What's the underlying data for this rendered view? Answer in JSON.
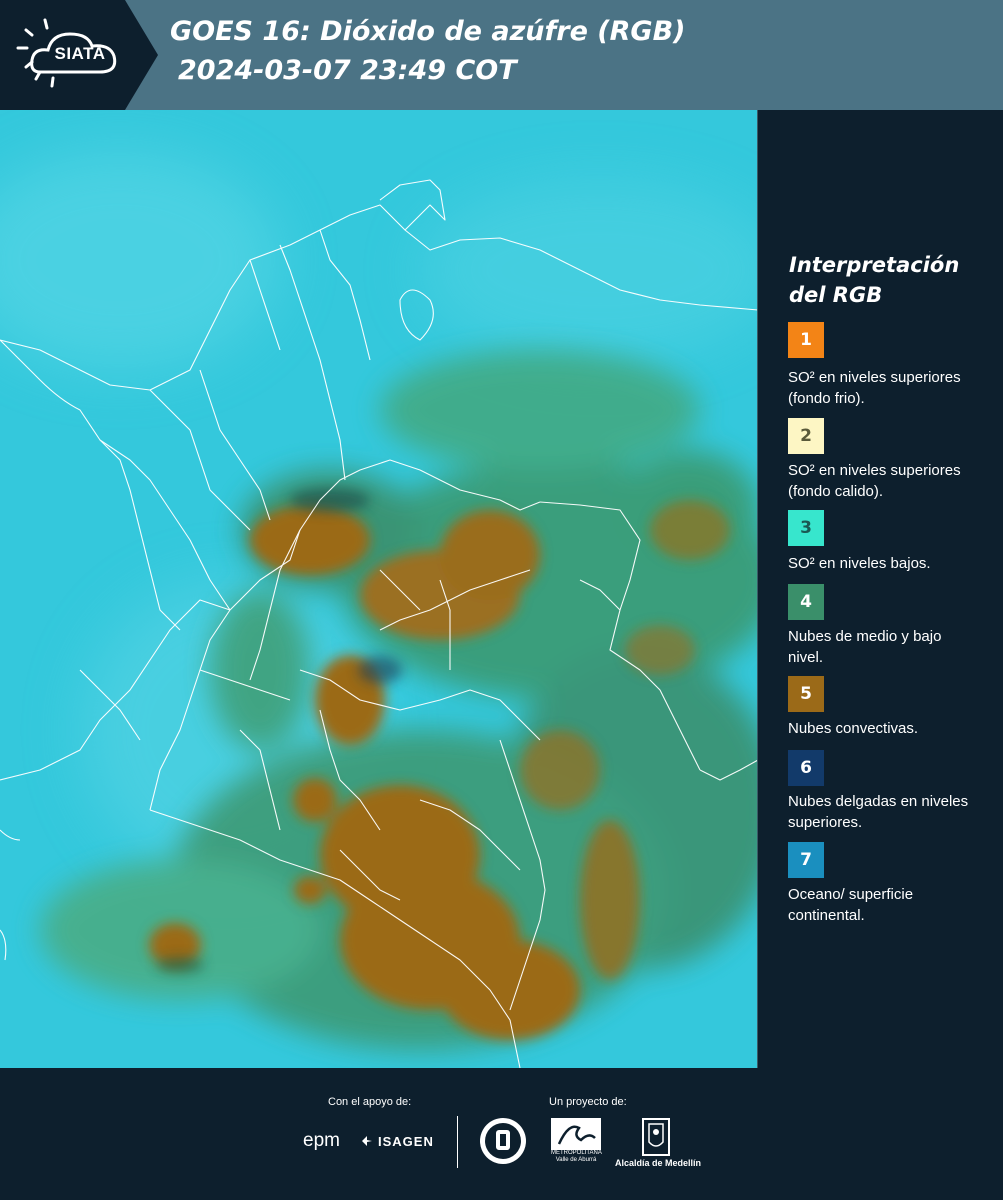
{
  "header": {
    "logo_text": "SIATA",
    "title_line1": "GOES 16: Dióxido de azúfre (RGB)",
    "title_line2": "2024-03-07 23:49 COT"
  },
  "legend": {
    "title": "Interpretación del RGB",
    "items": [
      {
        "number": "1",
        "color": "#f38416",
        "text_color": "#ffffff",
        "description": "SO² en niveles superiores (fondo frio)."
      },
      {
        "number": "2",
        "color": "#fdf6c4",
        "text_color": "#5a5a3a",
        "description": "SO² en niveles superiores (fondo calido)."
      },
      {
        "number": "3",
        "color": "#37e6cd",
        "text_color": "#1a5a54",
        "description": "SO² en niveles bajos."
      },
      {
        "number": "4",
        "color": "#3a8f6a",
        "text_color": "#ffffff",
        "description": "Nubes de medio y bajo nivel."
      },
      {
        "number": "5",
        "color": "#9b6a18",
        "text_color": "#ffffff",
        "description": "Nubes convectivas."
      },
      {
        "number": "6",
        "color": "#123a6a",
        "text_color": "#ffffff",
        "description": "Nubes delgadas en niveles superiores."
      },
      {
        "number": "7",
        "color": "#1a8fbf",
        "text_color": "#ffffff",
        "description": "Oceano/ superficie continental."
      }
    ]
  },
  "footer": {
    "support_label": "Con el apoyo de:",
    "project_label": "Un proyecto de:",
    "epm": "epm",
    "isagen": "ISAGEN",
    "area_text": "METROPOLITANA Valle de Aburrá",
    "alcaldia": "Alcaldía de Medellín"
  },
  "colors": {
    "header_bg": "#4b7385",
    "logo_bg": "#0d1f2d",
    "page_bg": "#0d1f2d",
    "ocean": "#2fc7d9",
    "convective": "#9b6a18",
    "mid_low_clouds": "#3a8f6a",
    "borders": "#ffffff"
  }
}
